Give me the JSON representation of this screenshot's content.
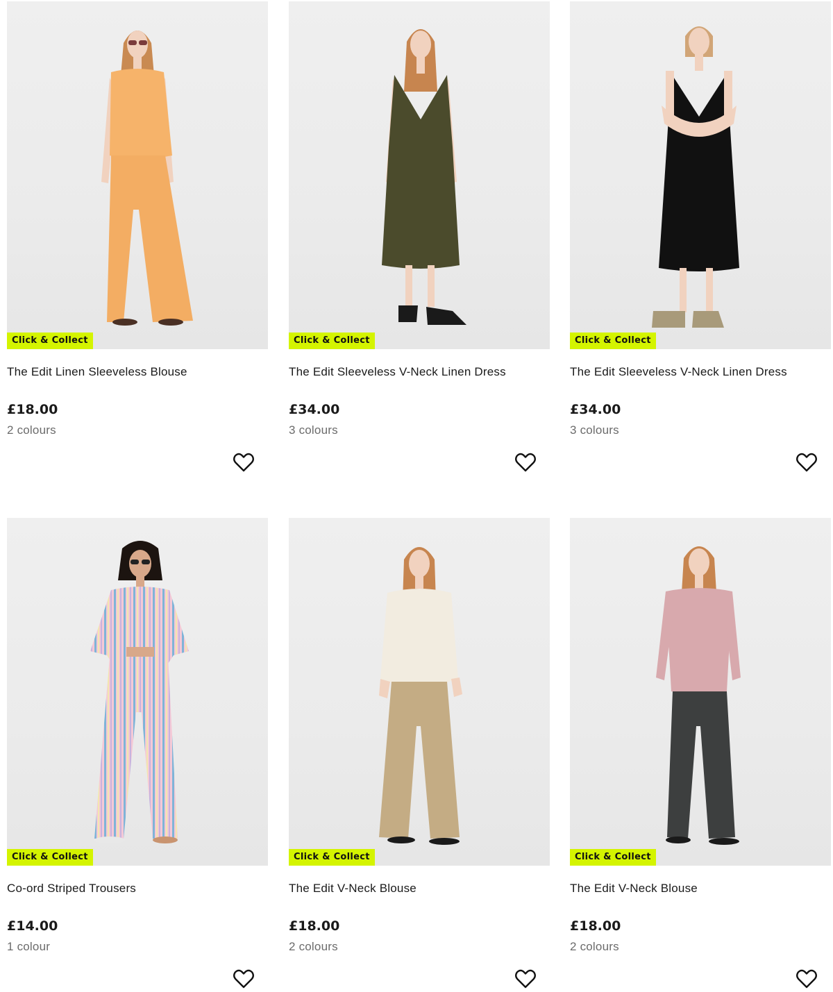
{
  "products": [
    {
      "badge": "Click & Collect",
      "title": "The Edit Linen Sleeveless Blouse",
      "price": "£18.00",
      "colours": "2 colours",
      "image": "model-orange-linen-set"
    },
    {
      "badge": "Click & Collect",
      "title": "The Edit Sleeveless V-Neck Linen Dress",
      "price": "£34.00",
      "colours": "3 colours",
      "image": "model-khaki-linen-dress"
    },
    {
      "badge": "Click & Collect",
      "title": "The Edit Sleeveless V-Neck Linen Dress",
      "price": "£34.00",
      "colours": "3 colours",
      "image": "model-black-linen-dress"
    },
    {
      "badge": "Click & Collect",
      "title": "Co-ord Striped Trousers",
      "price": "£14.00",
      "colours": "1 colour",
      "image": "model-striped-coord"
    },
    {
      "badge": "Click & Collect",
      "title": "The Edit V-Neck Blouse",
      "price": "£18.00",
      "colours": "2 colours",
      "image": "model-cream-blouse-beige-trousers"
    },
    {
      "badge": "Click & Collect",
      "title": "The Edit V-Neck Blouse",
      "price": "£18.00",
      "colours": "2 colours",
      "image": "model-pink-blouse-grey-jeans"
    }
  ],
  "colors": {
    "badge_bg": "#d4f400",
    "text": "#1a1a1a",
    "muted": "#6b6b6b"
  },
  "icons": {
    "wishlist": "heart-outline-icon"
  }
}
